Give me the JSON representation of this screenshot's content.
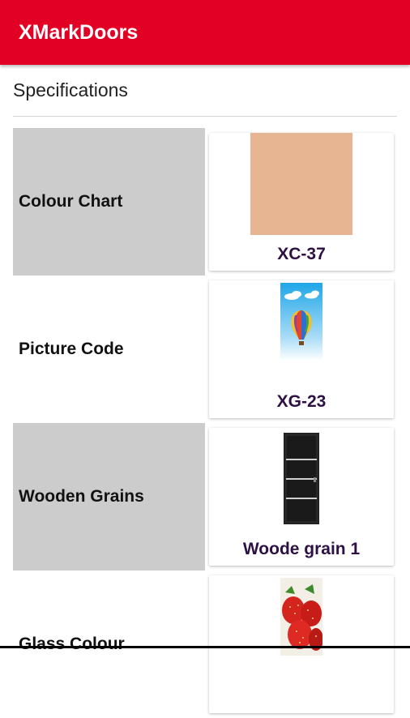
{
  "app": {
    "title": "XMarkDoors"
  },
  "page": {
    "section_title": "Specifications"
  },
  "rows": [
    {
      "label": "Colour Chart",
      "caption": "XC-37",
      "swatch_color": "#e8b592",
      "image_icon": "colour-swatch"
    },
    {
      "label": "Picture Code",
      "caption": "XG-23",
      "image_icon": "hot-air-balloon-picture"
    },
    {
      "label": "Wooden Grains",
      "caption": "Woode grain 1",
      "image_icon": "black-door-picture"
    },
    {
      "label": "Glass Colour",
      "caption": "",
      "image_icon": "strawberries-picture"
    }
  ],
  "colors": {
    "appbar": "#e30025",
    "label_shade": "#cccccc",
    "caption_text": "#2e1044"
  }
}
